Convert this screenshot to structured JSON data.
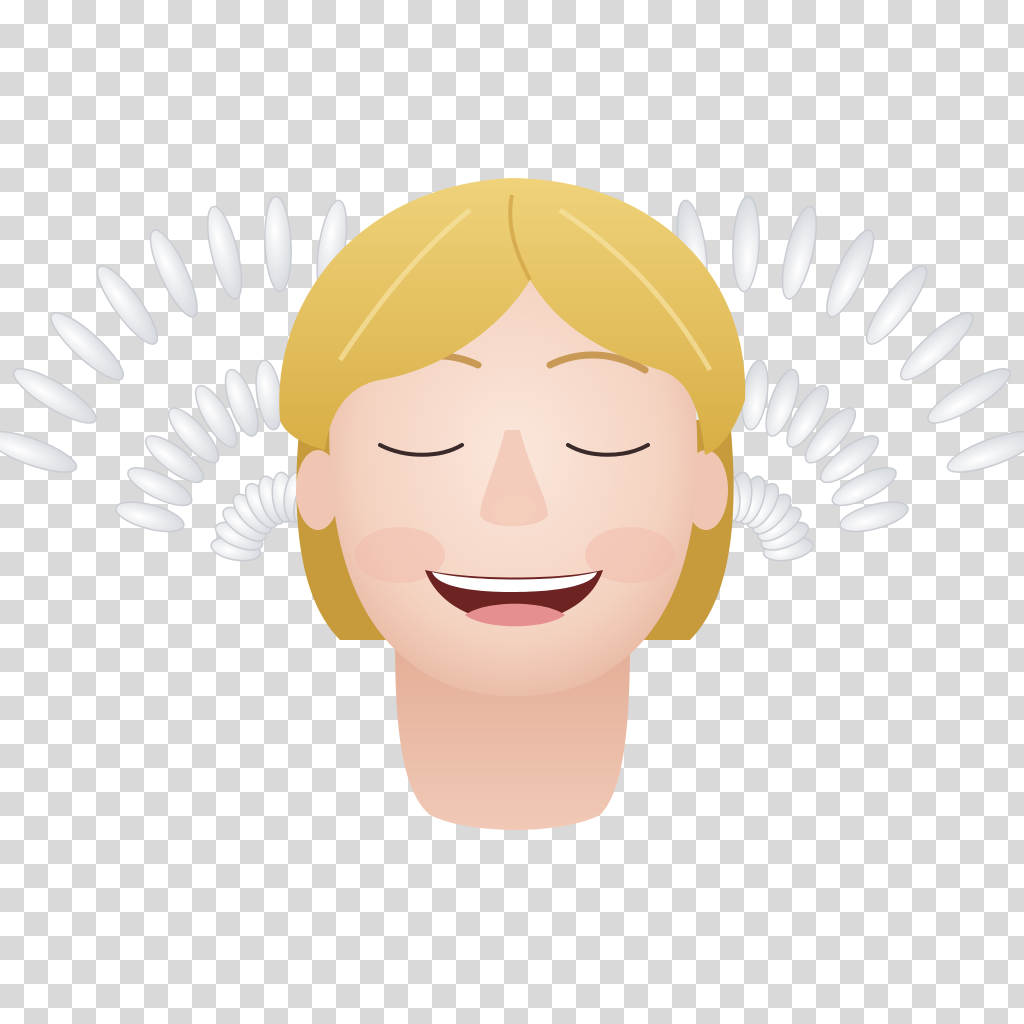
{
  "image": {
    "subject": "angel-head-emoji",
    "background": "transparency-checkerboard",
    "colors": {
      "checker_light": "#ffffff",
      "checker_dark": "#d9d9d9",
      "hair": "#e6c35a",
      "hair_shadow": "#c9a23a",
      "skin": "#f7dccb",
      "skin_shadow": "#e9b9a3",
      "wing": "#f3f4f6",
      "wing_shadow": "#d4d7dc",
      "mouth": "#7a2a2a",
      "teeth": "#ffffff",
      "tongue": "#e58f90"
    }
  }
}
